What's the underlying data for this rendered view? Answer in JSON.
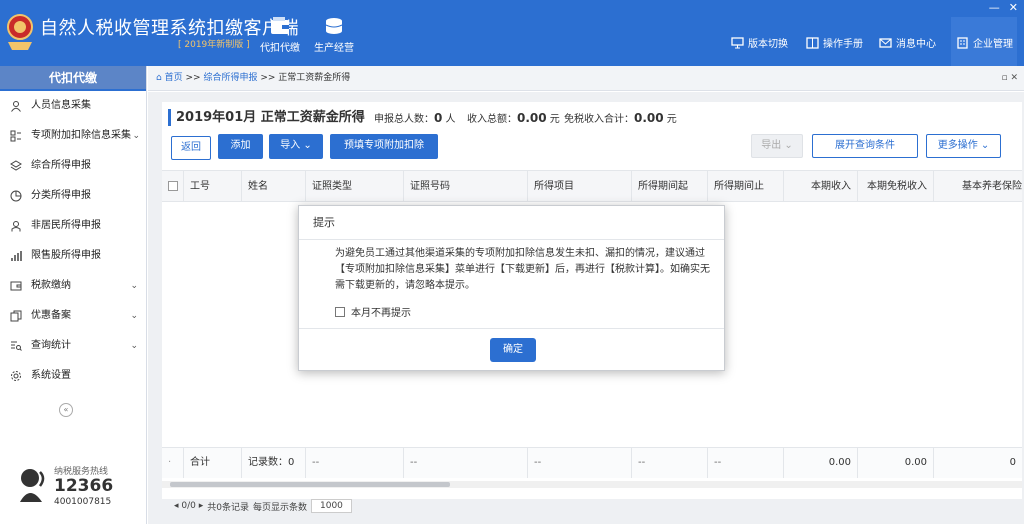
{
  "app": {
    "title": "自然人税收管理系统扣缴客户端",
    "subtitle": "[ 2019年新制版 ]"
  },
  "modules": [
    {
      "label": "代扣代缴",
      "icon": "wallet-icon"
    },
    {
      "label": "生产经营",
      "icon": "coins-icon"
    }
  ],
  "top_menu": [
    {
      "label": "版本切换",
      "icon": "monitor-icon"
    },
    {
      "label": "操作手册",
      "icon": "book-icon"
    },
    {
      "label": "消息中心",
      "icon": "mail-icon"
    },
    {
      "label": "企业管理",
      "icon": "building-icon"
    }
  ],
  "window_controls": {
    "minimize": "—",
    "close": "✕"
  },
  "sidebar": {
    "header": "代扣代缴",
    "items": [
      {
        "label": "人员信息采集",
        "icon": "person-icon"
      },
      {
        "label": "专项附加扣除信息采集",
        "icon": "list-icon",
        "chevron": "⌄"
      },
      {
        "label": "综合所得申报",
        "icon": "layers-icon"
      },
      {
        "label": "分类所得申报",
        "icon": "pie-icon"
      },
      {
        "label": "非居民所得申报",
        "icon": "user-icon"
      },
      {
        "label": "限售股所得申报",
        "icon": "bar-icon"
      },
      {
        "label": "税款缴纳",
        "icon": "wallet-icon",
        "chevron": "⌄"
      },
      {
        "label": "优惠备案",
        "icon": "copy-icon",
        "chevron": "⌄"
      },
      {
        "label": "查询统计",
        "icon": "query-icon",
        "chevron": "⌄"
      },
      {
        "label": "系统设置",
        "icon": "gear-icon"
      }
    ],
    "collapse": "«"
  },
  "hotline": {
    "label": "纳税服务热线",
    "number": "12366",
    "phone": "4001007815"
  },
  "breadcrumb": {
    "home": "首页",
    "sep": ">>",
    "level1": "综合所得申报",
    "current": "正常工资薪金所得",
    "controls": "▫ ✕"
  },
  "panel": {
    "title": "2019年01月  正常工资薪金所得",
    "stats": [
      {
        "label": "申报总人数：",
        "value": "0",
        "unit": "人"
      },
      {
        "label": "收入总额：",
        "value": "0.00",
        "unit": "元"
      },
      {
        "label": "免税收入合计：",
        "value": "0.00",
        "unit": "元"
      }
    ]
  },
  "buttons": {
    "back": "返回",
    "add": "添加",
    "import": "导入",
    "import_arrow": "⌄",
    "prefill": "预填专项附加扣除",
    "export": "导出",
    "export_arrow": "⌄",
    "expand": "展开查询条件",
    "more": "更多操作",
    "more_arrow": "⌄"
  },
  "table": {
    "columns": [
      "工号",
      "姓名",
      "证照类型",
      "证照号码",
      "所得项目",
      "所得期间起",
      "所得期间止",
      "本期收入",
      "本期免税收入",
      "基本养老保险"
    ],
    "footer": {
      "dot": "·",
      "label": "合计",
      "records": "记录数：0",
      "dash": "--",
      "income": "0.00",
      "tax_free": "0.00",
      "last": "0"
    }
  },
  "pager": {
    "nav": "◂ 0/0 ▸",
    "total": "共0条记录",
    "per_page_label": "每页显示条数",
    "per_page": "1000"
  },
  "dialog": {
    "title": "提示",
    "message": "为避免员工通过其他渠道采集的专项附加扣除信息发生未扣、漏扣的情况，建议通过【专项附加扣除信息采集】菜单进行【下载更新】后，再进行【税款计算】。如确实无需下载更新的，请忽略本提示。",
    "checkbox": "本月不再提示",
    "ok": "确定"
  },
  "colors": {
    "primary": "#2c6fd1",
    "header": "#2c6fd1",
    "sidehdr": "#5c85c7",
    "accent": "#f2c46a"
  }
}
